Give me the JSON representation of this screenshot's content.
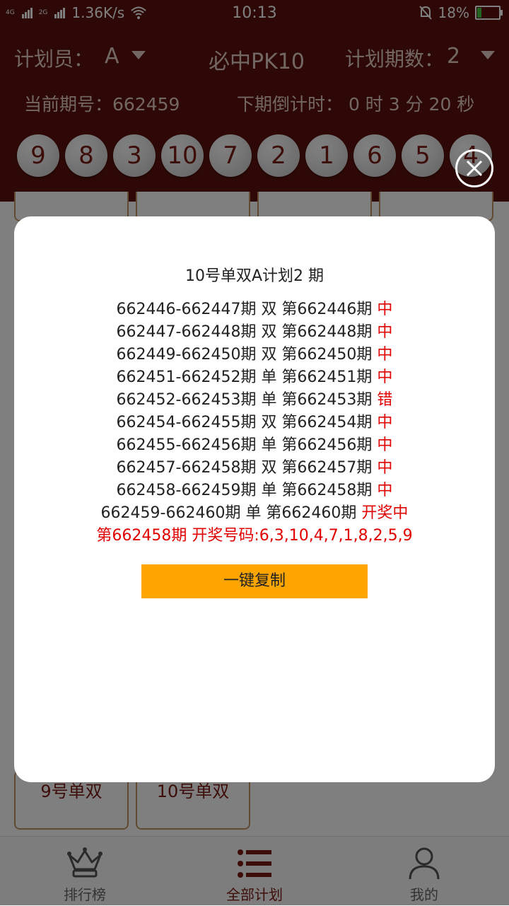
{
  "status_bar": {
    "network1": "4G",
    "network2": "2G",
    "speed": "1.36K/s",
    "time": "10:13",
    "battery": "18%",
    "battery_fraction": 0.18
  },
  "header": {
    "planner_label": "计划员：",
    "planner_value": "A",
    "title": "必中PK10",
    "periods_label": "计划期数：",
    "periods_value": "2",
    "current_issue": "当前期号：662459",
    "countdown": "下期倒计时： 0 时 3 分 20 秒",
    "balls": [
      "9",
      "8",
      "3",
      "10",
      "7",
      "2",
      "1",
      "6",
      "5",
      "4"
    ]
  },
  "background_cards": {
    "bottom_left": "9号单双",
    "bottom_right": "10号单双"
  },
  "modal": {
    "title": "10号单双A计划2 期",
    "rows": [
      {
        "text": "662446-662447期 双   第662446期",
        "status": "中"
      },
      {
        "text": "662447-662448期 双   第662448期",
        "status": "中"
      },
      {
        "text": "662449-662450期 双   第662450期",
        "status": "中"
      },
      {
        "text": "662451-662452期 单   第662451期",
        "status": "中"
      },
      {
        "text": "662452-662453期 单   第662453期",
        "status": "错"
      },
      {
        "text": "662454-662455期 双   第662454期",
        "status": "中"
      },
      {
        "text": "662455-662456期 单   第662456期",
        "status": "中"
      },
      {
        "text": "662457-662458期 双   第662457期",
        "status": "中"
      },
      {
        "text": "662458-662459期 单   第662458期",
        "status": "中"
      },
      {
        "text": "662459-662460期 单   第662460期",
        "status": "开奖中"
      }
    ],
    "draw_line": "第662458期   开奖号码:6,3,10,4,7,1,8,2,5,9",
    "copy_button": "一键复制"
  },
  "tabbar": {
    "tabs": [
      {
        "label": "排行榜",
        "icon": "crown-icon"
      },
      {
        "label": "全部计划",
        "icon": "list-icon"
      },
      {
        "label": "我的",
        "icon": "user-icon"
      }
    ]
  },
  "colors": {
    "header_bg": "#5b110d",
    "accent": "#7a1a12",
    "copy_button": "#ffa500",
    "status_red": "#e00000"
  }
}
